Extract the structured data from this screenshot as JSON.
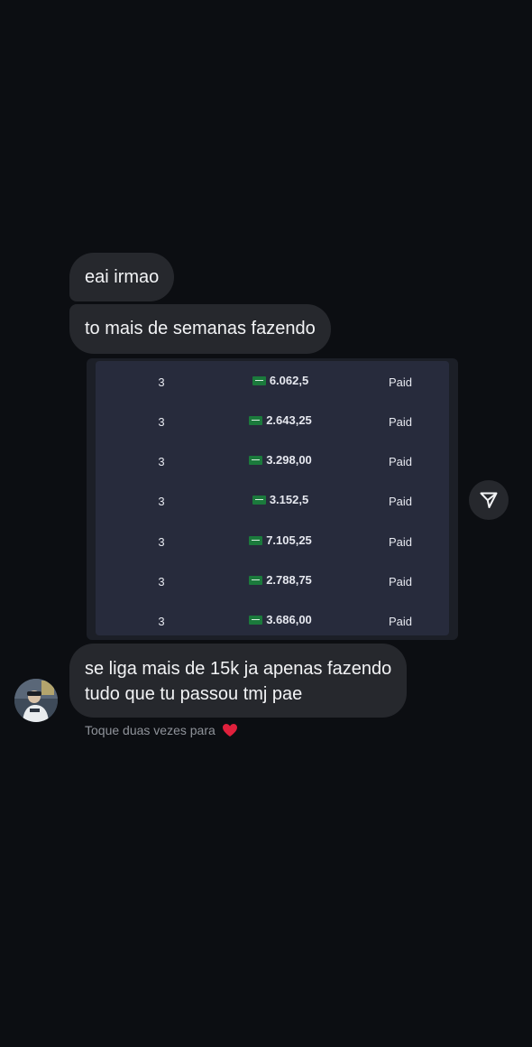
{
  "messages": [
    {
      "text": "eai irmao"
    },
    {
      "text": "to mais de semanas fazendo"
    },
    {
      "lines": [
        "se liga mais de 15k ja apenas fazendo",
        "tudo que tu passou tmj pae"
      ]
    }
  ],
  "shared_image": {
    "rows": [
      {
        "qty": "3",
        "amount": "6.062,5",
        "status": "Paid"
      },
      {
        "qty": "3",
        "amount": "2.643,25",
        "status": "Paid"
      },
      {
        "qty": "3",
        "amount": "3.298,00",
        "status": "Paid"
      },
      {
        "qty": "3",
        "amount": "3.152,5",
        "status": "Paid"
      },
      {
        "qty": "3",
        "amount": "7.105,25",
        "status": "Paid"
      },
      {
        "qty": "3",
        "amount": "2.788,75",
        "status": "Paid"
      },
      {
        "qty": "3",
        "amount": "3.686,00",
        "status": "Paid"
      }
    ],
    "currency_icon": "saudi-flag-icon"
  },
  "reaction_hint": {
    "text": "Toque duas vezes para",
    "icon": "red-heart-icon"
  },
  "icons": {
    "share": "send-arrow-icon",
    "avatar": "contact-avatar"
  },
  "colors": {
    "background": "#0c0e12",
    "bubble": "#26282d",
    "panel": "#272b3c",
    "heart": "#e0203c",
    "hint_text": "#8f939a"
  }
}
